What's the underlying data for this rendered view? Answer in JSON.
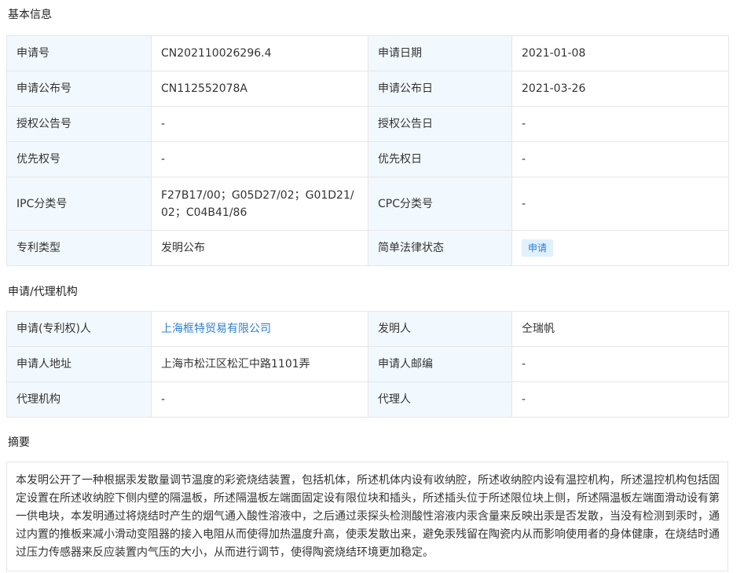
{
  "sections": {
    "basic_title": "基本信息",
    "agency_title": "申请/代理机构",
    "abstract_title": "摘要"
  },
  "basic": {
    "application_no_label": "申请号",
    "application_no": "CN202110026296.4",
    "application_date_label": "申请日期",
    "application_date": "2021-01-08",
    "publication_no_label": "申请公布号",
    "publication_no": "CN112552078A",
    "publication_date_label": "申请公布日",
    "publication_date": "2021-03-26",
    "grant_no_label": "授权公告号",
    "grant_no": "-",
    "grant_date_label": "授权公告日",
    "grant_date": "-",
    "priority_no_label": "优先权号",
    "priority_no": "-",
    "priority_date_label": "优先权日",
    "priority_date": "-",
    "ipc_label": "IPC分类号",
    "ipc_line1": "F27B17/00；G05D27/02；G01D21/",
    "ipc_line2": "02；C04B41/86",
    "cpc_label": "CPC分类号",
    "cpc": "-",
    "patent_type_label": "专利类型",
    "patent_type": "发明公布",
    "legal_status_label": "简单法律状态",
    "legal_status": "申请"
  },
  "agency": {
    "applicant_label": "申请(专利权)人",
    "applicant": "上海框特贸易有限公司",
    "inventor_label": "发明人",
    "inventor": "仝瑞帆",
    "address_label": "申请人地址",
    "address": "上海市松江区松汇中路1101弄",
    "postcode_label": "申请人邮编",
    "postcode": "-",
    "agency_label": "代理机构",
    "agency": "-",
    "agent_label": "代理人",
    "agent": "-"
  },
  "abstract": {
    "text": "本发明公开了一种根据汞发散量调节温度的彩瓷烧结装置，包括机体，所述机体内设有收纳腔，所述收纳腔内设有温控机构，所述温控机构包括固定设置在所述收纳腔下侧内壁的隔温板，所述隔温板左端面固定设有限位块和插头，所述插头位于所述限位块上侧，所述隔温板左端面滑动设有第一供电块，本发明通过将烧结时产生的烟气通入酸性溶液中，之后通过汞探头检测酸性溶液内汞含量来反映出汞是否发散，当没有检测到汞时，通过内置的推板来减小滑动变阻器的接入电阻从而使得加热温度升高，使汞发散出来，避免汞残留在陶瓷内从而影响使用者的身体健康，在烧结时通过压力传感器来反应装置内气压的大小，从而进行调节，使得陶瓷烧结环境更加稳定。"
  },
  "colors": {
    "label_bg": "#f2f9fe",
    "border": "#e6e6e6",
    "link": "#2d7fd3",
    "badge_bg": "#e1f0fd"
  }
}
